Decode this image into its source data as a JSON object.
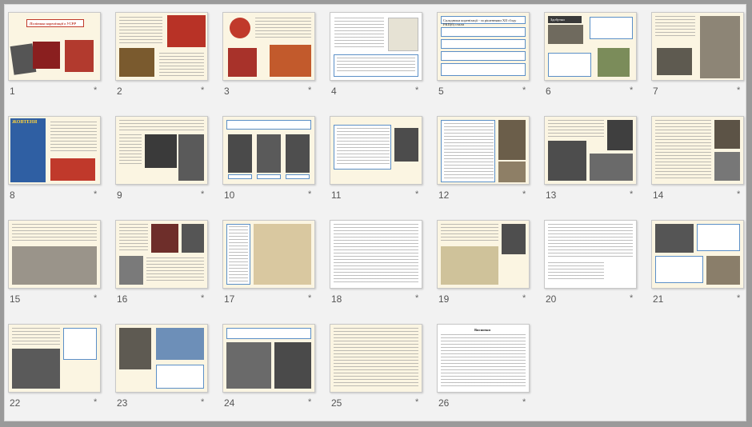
{
  "slides": [
    {
      "num": "1",
      "star": "*",
      "title": "Політика коренізації в УСРР"
    },
    {
      "num": "2",
      "star": "*"
    },
    {
      "num": "3",
      "star": "*"
    },
    {
      "num": "4",
      "star": "*"
    },
    {
      "num": "5",
      "star": "*",
      "title": "Складники коренізації - за рішеннями XII з'їзду РКП(б) стали"
    },
    {
      "num": "6",
      "star": "*",
      "title": "Здобутки"
    },
    {
      "num": "7",
      "star": "*"
    },
    {
      "num": "8",
      "star": "*",
      "title": "ЖОВТЕНЯ"
    },
    {
      "num": "9",
      "star": "*"
    },
    {
      "num": "10",
      "star": "*"
    },
    {
      "num": "11",
      "star": "*"
    },
    {
      "num": "12",
      "star": "*"
    },
    {
      "num": "13",
      "star": "*"
    },
    {
      "num": "14",
      "star": "*"
    },
    {
      "num": "15",
      "star": "*"
    },
    {
      "num": "16",
      "star": "*"
    },
    {
      "num": "17",
      "star": "*"
    },
    {
      "num": "18",
      "star": "*"
    },
    {
      "num": "19",
      "star": "*"
    },
    {
      "num": "20",
      "star": "*"
    },
    {
      "num": "21",
      "star": "*"
    },
    {
      "num": "22",
      "star": "*"
    },
    {
      "num": "23",
      "star": "*"
    },
    {
      "num": "24",
      "star": "*"
    },
    {
      "num": "25",
      "star": "*"
    },
    {
      "num": "26",
      "star": "*",
      "title": "Висновки"
    }
  ],
  "colors": {
    "slide_bg": "#fbf5e2",
    "accent": "#c0392b",
    "border_blue": "#5b8fc7"
  }
}
